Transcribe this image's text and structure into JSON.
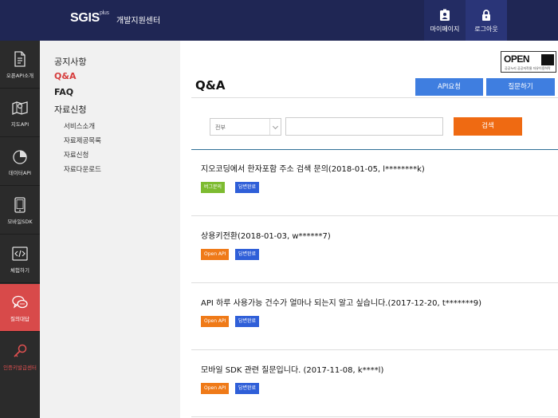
{
  "header": {
    "logo": "SGIS",
    "logo_sup": "plus",
    "subtitle": "개발지원센터",
    "mypage_label": "마이페이지",
    "logout_label": "로그아웃"
  },
  "leftbar": {
    "items": [
      {
        "label": "오픈API소개",
        "icon": "document-icon"
      },
      {
        "label": "지도API",
        "icon": "map-icon"
      },
      {
        "label": "데이터API",
        "icon": "pie-chart-icon"
      },
      {
        "label": "모바일SDK",
        "icon": "tablet-icon"
      },
      {
        "label": "체험하기",
        "icon": "code-icon"
      },
      {
        "label": "질의대답",
        "icon": "chat-bubbles-icon"
      },
      {
        "label": "인증키발급센터",
        "icon": "key-icon"
      }
    ]
  },
  "subnav": {
    "notice": "공지사항",
    "qa": "Q&A",
    "faq": "FAQ",
    "data_request": "자료신청",
    "sub_items": [
      "서비스소개",
      "자료제공목록",
      "자료신청",
      "자료다운로드"
    ]
  },
  "content": {
    "badge_text": "OPEN",
    "badge_sub": "공공누리 공공저작물 자유이용허락",
    "title": "Q&A",
    "api_request_label": "API요청",
    "ask_label": "질문하기",
    "filter_selected": "전부",
    "search_value": "",
    "search_button": "검색",
    "items": [
      {
        "question": "지오코딩에서 한자포함 주소 검색 문의(2018-01-05, l********k)",
        "tag1": "버그문의",
        "tag2": "답변완료"
      },
      {
        "question": "상용키전환(2018-01-03, w******7)",
        "tag1": "Open API",
        "tag2": "답변완료"
      },
      {
        "question": "API 하루 사용가능 건수가 얼마나 되는지 알고 싶습니다.(2017-12-20, t*******9)",
        "tag1": "Open API",
        "tag2": "답변완료"
      },
      {
        "question": "모바일 SDK 관련 질문입니다. (2017-11-08, k****l)",
        "tag1": "Open API",
        "tag2": "답변완료"
      }
    ]
  },
  "colors": {
    "header_bg": "#1f2654",
    "active_red": "#d84a4a",
    "blue_button": "#3f7ee0",
    "orange_button": "#ef6a12",
    "tag_green": "#7dbb30",
    "tag_orange": "#ef7a18",
    "tag_blue": "#2f5fd8"
  }
}
